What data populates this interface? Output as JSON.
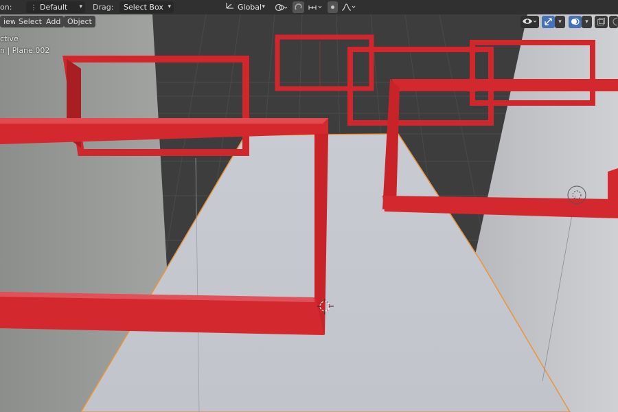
{
  "header": {
    "orientation_label": "on:",
    "orientation_value": "Default",
    "drag_label": "Drag:",
    "drag_value": "Select Box",
    "transform_orientation_value": "Global"
  },
  "viewport": {
    "menu": {
      "view": "iew",
      "select": "Select",
      "add": "Add",
      "object": "Object"
    },
    "info": {
      "line1": "ctive",
      "line2": "n | Plane.002"
    }
  },
  "icons": {
    "orientation": "transform-orientation-icon",
    "drag_select": "select-box-icon",
    "pivot": "pivot-point-icon",
    "snap": "snap-icon",
    "snap_increment": "snap-increment-icon",
    "proportional": "proportional-editing-icon",
    "falloff": "falloff-curve-icon",
    "visibility": "eye-visibility-icon",
    "gizmo": "gizmo-icon",
    "overlays": "overlays-icon",
    "xray": "xray-icon"
  },
  "colors": {
    "header_bg": "#303030",
    "viewport_bg": "#3d3d3d",
    "active_blue": "#4772b3",
    "frame_red": "#d6262b",
    "selection_orange": "#e8953c",
    "wall_gray": "#9a9c98",
    "floor_light": "#c6c9d0"
  }
}
